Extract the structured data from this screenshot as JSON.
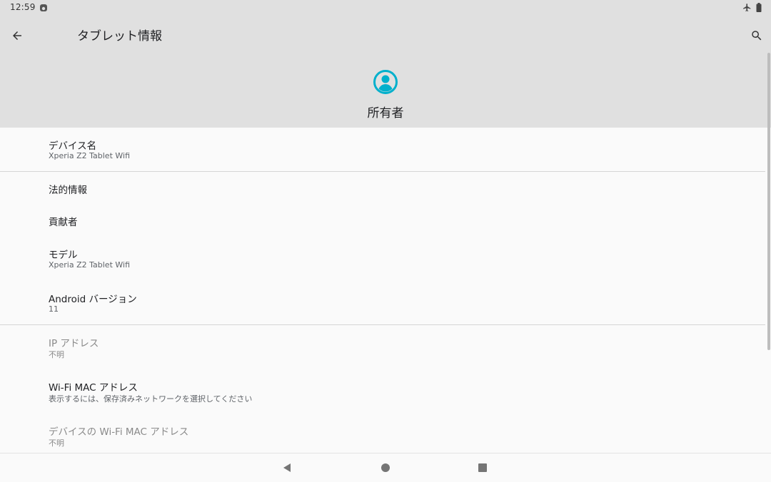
{
  "status_bar": {
    "time": "12:59",
    "icons": [
      "notification-icon",
      "airplane-mode-icon",
      "battery-icon"
    ]
  },
  "header": {
    "title": "タブレット情報",
    "owner_label": "所有者",
    "accent_color": "#00b0cc"
  },
  "items": [
    {
      "title": "デバイス名",
      "subtitle": "Xperia Z2 Tablet Wifi"
    },
    {
      "title": "法的情報"
    },
    {
      "title": "貢献者"
    },
    {
      "title": "モデル",
      "subtitle": "Xperia Z2 Tablet Wifi"
    },
    {
      "title": "Android バージョン",
      "subtitle": "11"
    },
    {
      "title": "IP アドレス",
      "subtitle": "不明",
      "disabled": true
    },
    {
      "title": "Wi-Fi MAC アドレス",
      "subtitle": "表示するには、保存済みネットワークを選択してください"
    },
    {
      "title": "デバイスの Wi-Fi MAC アドレス",
      "subtitle": "不明",
      "disabled": true
    }
  ],
  "nav_icons": [
    "back-triangle-icon",
    "home-circle-icon",
    "recents-square-icon"
  ]
}
